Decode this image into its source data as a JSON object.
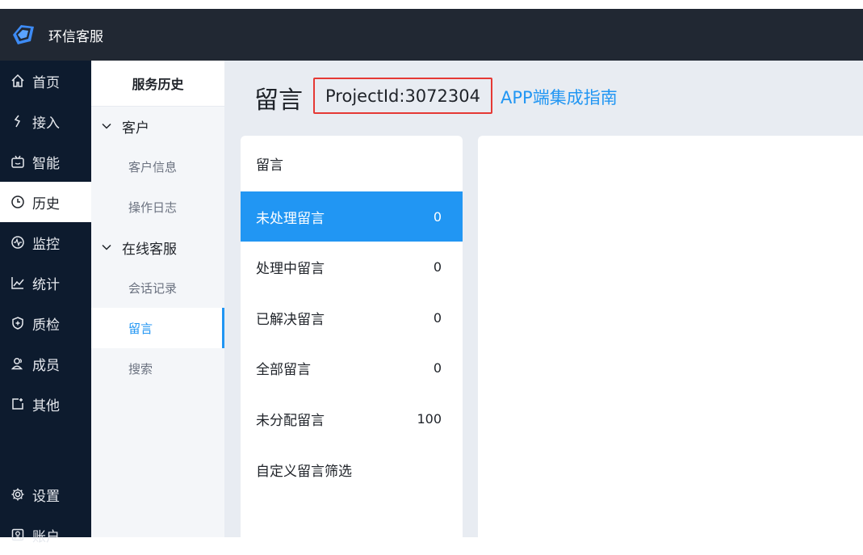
{
  "app": {
    "title": "环信客服"
  },
  "colors": {
    "topbar": "#212833",
    "nav": "#0d1b2e",
    "accent": "#2196f3",
    "highlight_box": "#e53935",
    "main_bg": "#e8ecf2"
  },
  "nav": {
    "items": [
      {
        "label": "首页",
        "icon": "home-icon"
      },
      {
        "label": "接入",
        "icon": "plug-icon"
      },
      {
        "label": "智能",
        "icon": "robot-icon"
      },
      {
        "label": "历史",
        "icon": "clock-icon",
        "active": true
      },
      {
        "label": "监控",
        "icon": "pulse-icon"
      },
      {
        "label": "统计",
        "icon": "chart-line-icon"
      },
      {
        "label": "质检",
        "icon": "shield-icon"
      },
      {
        "label": "成员",
        "icon": "users-icon"
      },
      {
        "label": "其他",
        "icon": "external-icon"
      },
      {
        "label": "设置",
        "icon": "gear-icon"
      },
      {
        "label": "账户",
        "icon": "account-icon"
      }
    ]
  },
  "subnav": {
    "header": "服务历史",
    "group_customer": "客户",
    "customer_info": "客户信息",
    "operation_log": "操作日志",
    "group_online": "在线客服",
    "session_records": "会话记录",
    "messages": "留言",
    "search": "搜索"
  },
  "main": {
    "title": "留言",
    "project_id": "ProjectId:3072304",
    "guide_link": "APP端集成指南"
  },
  "filters": {
    "title": "留言",
    "rows": [
      {
        "label": "未处理留言",
        "count": "0",
        "active": true
      },
      {
        "label": "处理中留言",
        "count": "0"
      },
      {
        "label": "已解决留言",
        "count": "0"
      },
      {
        "label": "全部留言",
        "count": "0"
      },
      {
        "label": "未分配留言",
        "count": "100"
      },
      {
        "label": "自定义留言筛选",
        "count": ""
      }
    ]
  }
}
